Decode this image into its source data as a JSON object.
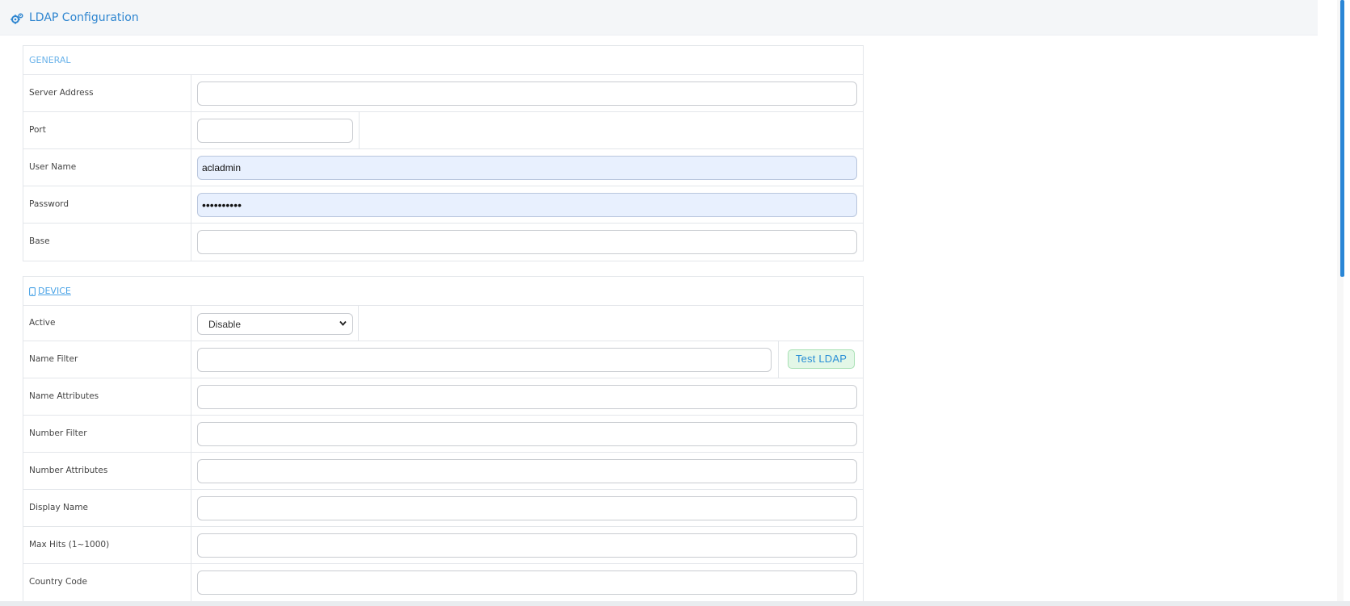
{
  "header": {
    "title": "LDAP Configuration",
    "icon": "gears-icon"
  },
  "general": {
    "section_title": "GENERAL",
    "server_address": {
      "label": "Server Address",
      "value": ""
    },
    "port": {
      "label": "Port",
      "value": ""
    },
    "user_name": {
      "label": "User Name",
      "value": "acladmin"
    },
    "password": {
      "label": "Password",
      "value": "••••••••••"
    },
    "base": {
      "label": "Base",
      "value": ""
    }
  },
  "device": {
    "section_title": "DEVICE",
    "icon": "mobile-device-icon",
    "active": {
      "label": "Active",
      "value": "Disable"
    },
    "name_filter": {
      "label": "Name Filter",
      "value": ""
    },
    "test_button": "Test LDAP",
    "name_attributes": {
      "label": "Name Attributes",
      "value": ""
    },
    "number_filter": {
      "label": "Number Filter",
      "value": ""
    },
    "number_attributes": {
      "label": "Number Attributes",
      "value": ""
    },
    "display_name": {
      "label": "Display Name",
      "value": ""
    },
    "max_hits": {
      "label": "Max Hits (1~1000)",
      "value": ""
    },
    "country_code": {
      "label": "Country Code",
      "value": ""
    }
  },
  "colors": {
    "accent": "#2f86d0",
    "test_button_bg": "#e3f7e7",
    "autofill_bg": "#e8f0fe",
    "scrollbar": "#2a86d6"
  }
}
